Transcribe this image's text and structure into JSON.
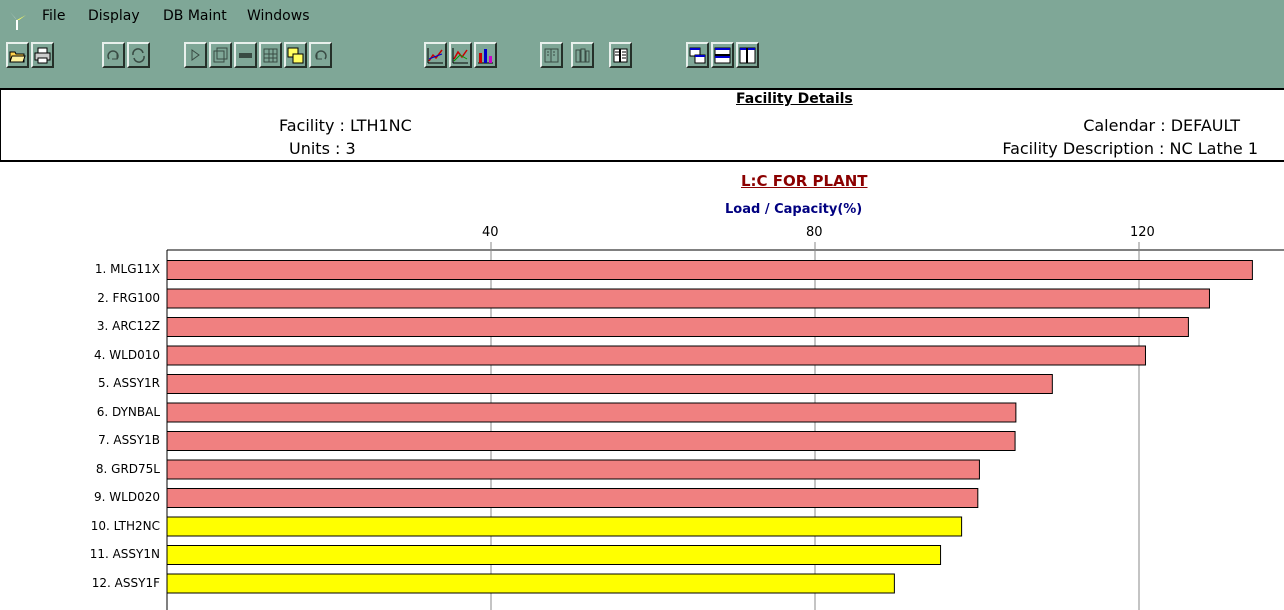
{
  "menu": {
    "items": [
      "File",
      "Display",
      "DB Maint",
      "Windows"
    ]
  },
  "toolbar": {
    "groups": [
      [
        "open-folder-icon",
        "print-icon"
      ],
      [
        "redo-icon",
        "refresh-icon"
      ],
      [
        "play-icon",
        "copy-window-icon",
        "arrow-left-icon",
        "grid-data-icon",
        "cascade-icon",
        "undo-icon"
      ],
      [
        "line-chart-icon",
        "line-chart-alt-icon",
        "bar-chart-icon"
      ],
      [
        "book-icon"
      ],
      [
        "books-icon"
      ],
      [
        "split-panel-icon"
      ],
      [
        "stack-windows-icon",
        "tile-horizontal-icon",
        "tile-vertical-icon"
      ]
    ],
    "disabled": [
      "redo-icon",
      "refresh-icon",
      "play-icon",
      "copy-window-icon",
      "arrow-left-icon",
      "grid-data-icon",
      "undo-icon",
      "book-icon",
      "books-icon"
    ]
  },
  "details": {
    "title": "Facility Details",
    "facility": "Facility : LTH1NC",
    "units": "Units : 3",
    "calendar": "Calendar : DEFAULT",
    "description": "Facility Description : NC Lathe 1"
  },
  "chart_data": {
    "type": "bar",
    "orientation": "horizontal",
    "title": "L:C FOR PLANT",
    "xlabel": "Load / Capacity(%)",
    "x_ticks": [
      40,
      80,
      120
    ],
    "categories": [
      "1. MLG11X",
      "2. FRG100",
      "3. ARC12Z",
      "4. WLD010",
      "5. ASSY1R",
      "6. DYNBAL",
      "7. ASSY1B",
      "8. GRD75L",
      "9. WLD020",
      "10. LTH2NC",
      "11. ASSY1N",
      "12. ASSY1F"
    ],
    "values": [
      134,
      128.7,
      126.1,
      120.8,
      109.3,
      104.8,
      104.7,
      100.3,
      100.1,
      98.1,
      95.5,
      89.8
    ],
    "colors": [
      "#F08080",
      "#F08080",
      "#F08080",
      "#F08080",
      "#F08080",
      "#F08080",
      "#F08080",
      "#F08080",
      "#F08080",
      "#FFFF00",
      "#FFFF00",
      "#FFFF00"
    ],
    "grid": true
  }
}
